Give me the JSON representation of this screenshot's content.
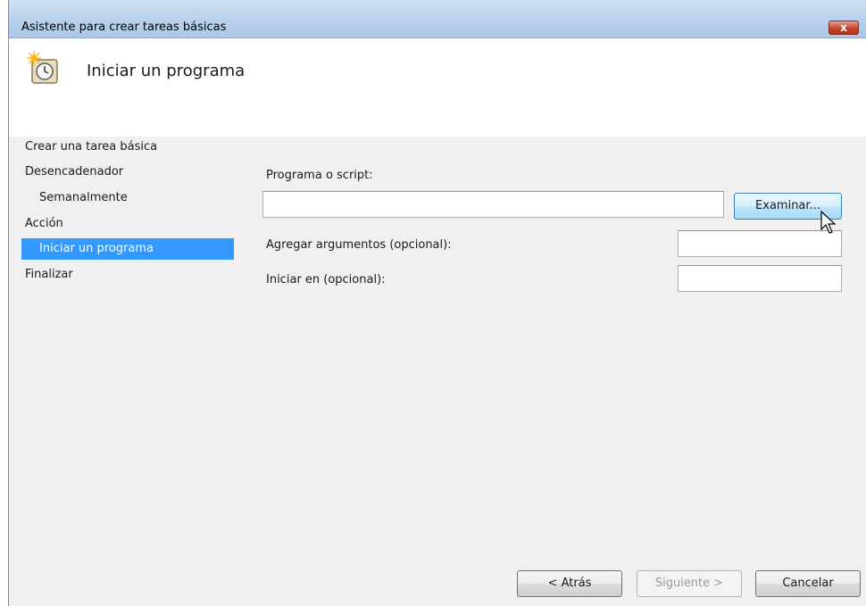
{
  "window": {
    "title": "Asistente para crear tareas básicas",
    "close_label": "x"
  },
  "header": {
    "title": "Iniciar un programa",
    "icon": "task-scheduler-clock-icon"
  },
  "nav": {
    "items": [
      {
        "label": "Crear una tarea básica"
      },
      {
        "label": "Desencadenador"
      },
      {
        "label": "Semanalmente"
      },
      {
        "label": "Acción"
      },
      {
        "label": "Iniciar un programa",
        "selected": true
      },
      {
        "label": "Finalizar"
      }
    ]
  },
  "form": {
    "program_label": "Programa o script:",
    "program_value": "",
    "browse_label": "Examinar...",
    "args_label": "Agregar argumentos (opcional):",
    "args_value": "",
    "start_in_label": "Iniciar en (opcional):",
    "start_in_value": ""
  },
  "footer": {
    "back_label": "< Atrás",
    "next_label": "Siguiente >",
    "cancel_label": "Cancelar"
  },
  "colors": {
    "selection": "#3399ff",
    "panel": "#f0f0f0",
    "titlebar": "#b9d1ec"
  }
}
